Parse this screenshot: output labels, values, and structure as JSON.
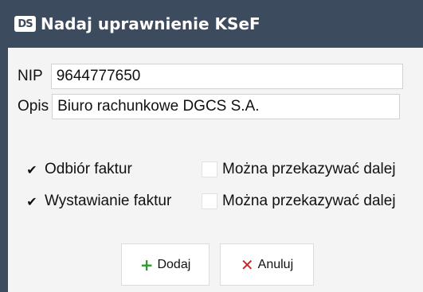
{
  "window": {
    "logo_text": "DS",
    "title": "Nadaj uprawnienie KSeF"
  },
  "form": {
    "nip_label": "NIP",
    "nip_value": "9644777650",
    "opis_label": "Opis",
    "opis_value": "Biuro rachunkowe DGCS S.A."
  },
  "permissions": [
    {
      "label": "Odbiór faktur",
      "checked": true,
      "transfer_label": "Można przekazywać dalej",
      "transfer_checked": false
    },
    {
      "label": "Wystawianie faktur",
      "checked": true,
      "transfer_label": "Można przekazywać dalej",
      "transfer_checked": false
    }
  ],
  "buttons": {
    "add_label": "Dodaj",
    "cancel_label": "Anuluj"
  },
  "colors": {
    "titlebar": "#3c4b5e",
    "add_icon": "#2e9a2e",
    "cancel_icon": "#d22222"
  }
}
